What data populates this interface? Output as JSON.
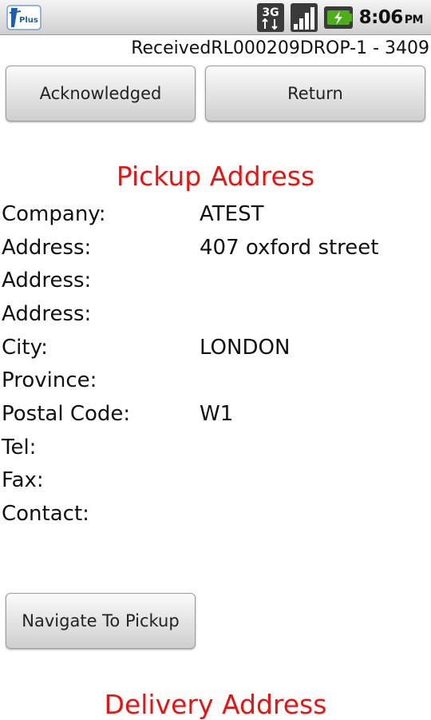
{
  "status_bar": {
    "app_icon_text": "Plus",
    "network_type": "3G",
    "time": "8:06",
    "ampm": "PM"
  },
  "header": {
    "status_text": "Received",
    "order_id": "RL000209DROP-1 - 3409"
  },
  "actions": {
    "acknowledged_label": "Acknowledged",
    "return_label": "Return"
  },
  "pickup": {
    "title": "Pickup Address",
    "fields": [
      {
        "label": "Company:",
        "value": "ATEST"
      },
      {
        "label": "Address:",
        "value": "407 oxford street"
      },
      {
        "label": "Address:",
        "value": ""
      },
      {
        "label": "Address:",
        "value": ""
      },
      {
        "label": "City:",
        "value": "LONDON"
      },
      {
        "label": "Province:",
        "value": ""
      },
      {
        "label": "Postal Code:",
        "value": "W1"
      },
      {
        "label": "Tel:",
        "value": ""
      },
      {
        "label": "Fax:",
        "value": ""
      },
      {
        "label": "Contact:",
        "value": ""
      }
    ],
    "navigate_label": "Navigate To Pickup"
  },
  "delivery": {
    "title": "Delivery Address"
  },
  "colors": {
    "section_title": "#ee1111",
    "battery_green": "#4caf1a"
  }
}
